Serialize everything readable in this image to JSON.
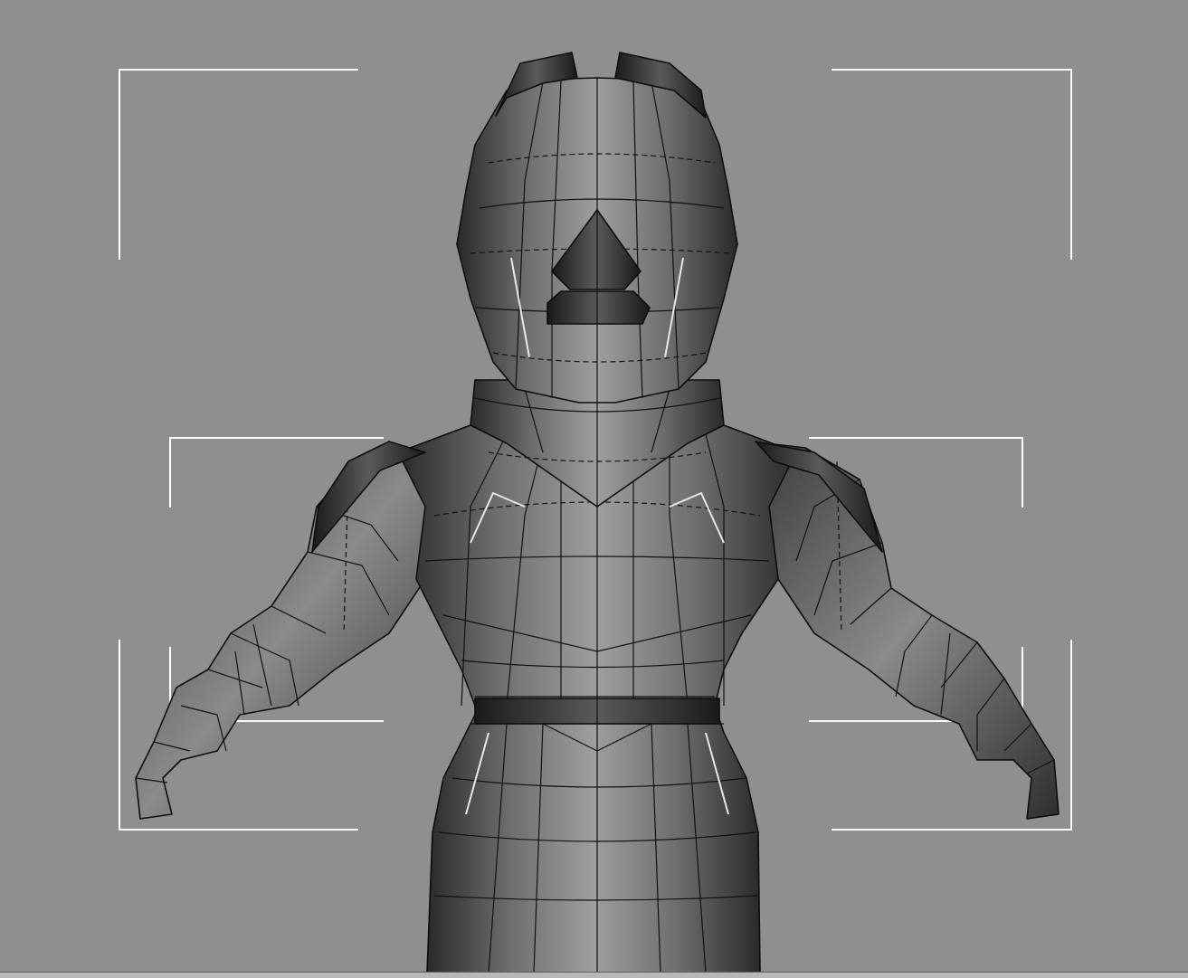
{
  "viewport": {
    "background": "#8f8f8f",
    "frame_guide_color": "#ffffff",
    "mesh_line_color": "#111111",
    "subject": "wireframe-character-mesh"
  }
}
